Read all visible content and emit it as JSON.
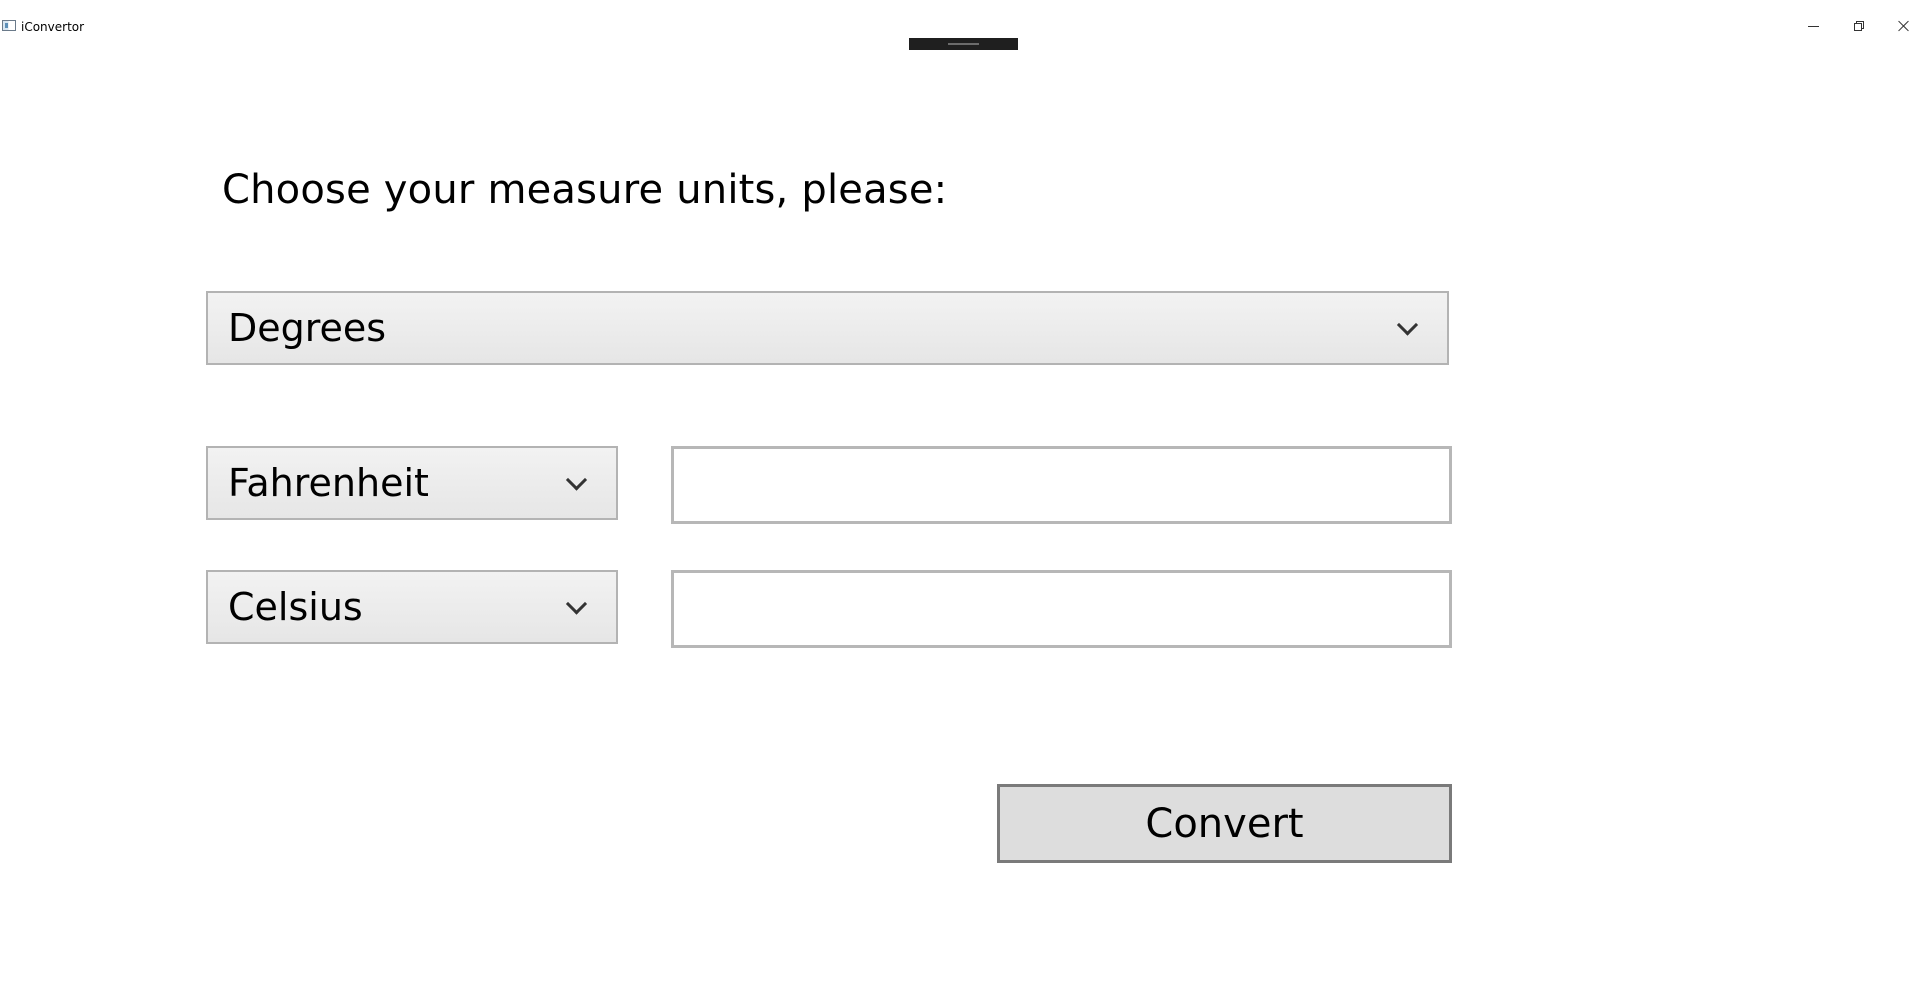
{
  "window": {
    "title": "iConvertor"
  },
  "main": {
    "prompt": "Choose your measure units, please:",
    "category_select": {
      "selected": "Degrees"
    },
    "from": {
      "unit": "Fahrenheit",
      "value": ""
    },
    "to": {
      "unit": "Celsius",
      "value": ""
    },
    "convert_label": "Convert"
  }
}
